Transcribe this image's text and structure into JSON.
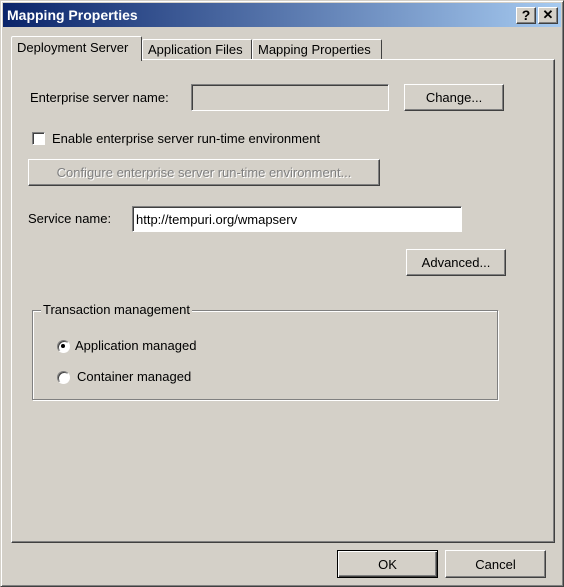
{
  "window": {
    "title": "Mapping Properties",
    "help_button": "?",
    "close_button": "✕"
  },
  "tabs": [
    {
      "label": "Deployment Server",
      "active": true
    },
    {
      "label": "Application Files",
      "active": false
    },
    {
      "label": "Mapping Properties",
      "active": false
    }
  ],
  "deployment": {
    "enterprise_server_label": "Enterprise server name:",
    "enterprise_server_value": "",
    "change_button": "Change...",
    "enable_runtime_label": "Enable enterprise server run-time environment",
    "enable_runtime_checked": false,
    "configure_button": "Configure enterprise server run-time environment...",
    "service_name_label": "Service name:",
    "service_name_value": "http://tempuri.org/wmapserv",
    "advanced_button": "Advanced..."
  },
  "transaction": {
    "legend": "Transaction management",
    "options": [
      {
        "label": "Application managed",
        "selected": true
      },
      {
        "label": "Container managed",
        "selected": false
      }
    ]
  },
  "footer": {
    "ok_button": "OK",
    "cancel_button": "Cancel"
  }
}
